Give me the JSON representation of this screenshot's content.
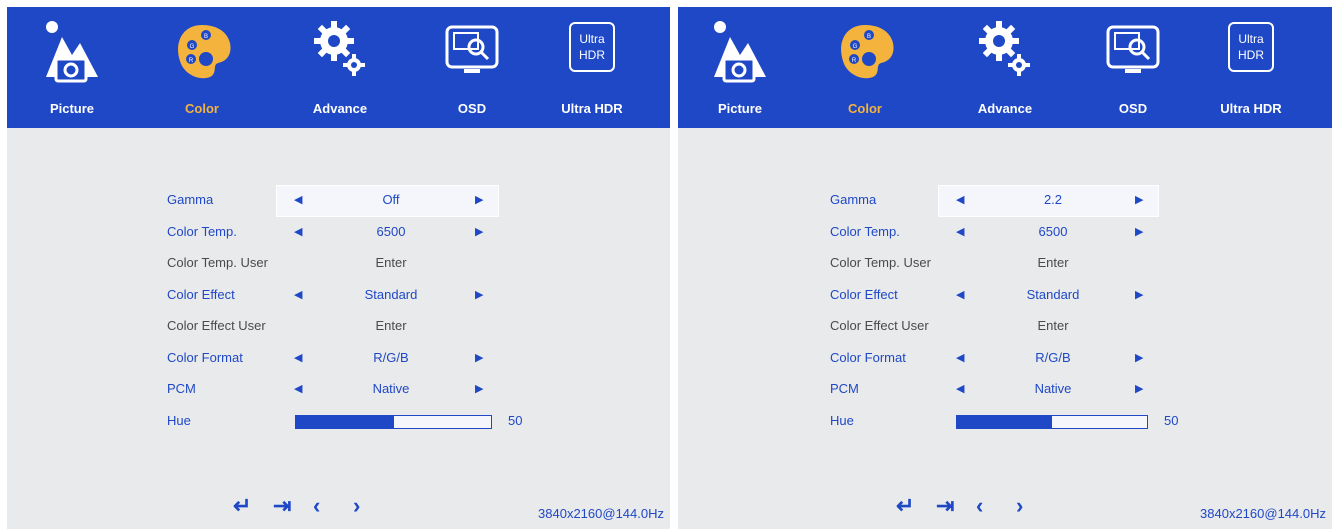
{
  "tabs": [
    {
      "label": "Picture",
      "icon": "picture-icon"
    },
    {
      "label": "Color",
      "icon": "palette-icon"
    },
    {
      "label": "Advance",
      "icon": "gear-icon"
    },
    {
      "label": "OSD",
      "icon": "osd-monitor-icon"
    },
    {
      "label": "Ultra HDR",
      "icon": "ultra-hdr-icon",
      "icon_text": [
        "Ultra",
        "HDR"
      ]
    }
  ],
  "active_tab": "Color",
  "colors": {
    "bar": "#1f48c6",
    "active": "#f3b33d",
    "text": "#1f48c6",
    "dim": "#4a4a4a"
  },
  "panels": [
    {
      "rows": [
        {
          "label": "Gamma",
          "value": "Off",
          "arrows": true,
          "selected": true
        },
        {
          "label": "Color Temp.",
          "value": "6500",
          "arrows": true
        },
        {
          "label": "Color Temp. User",
          "value": "Enter",
          "arrows": false
        },
        {
          "label": "Color Effect",
          "value": "Standard",
          "arrows": true
        },
        {
          "label": "Color Effect User",
          "value": "Enter",
          "arrows": false
        },
        {
          "label": "Color Format",
          "value": "R/G/B",
          "arrows": true
        },
        {
          "label": "PCM",
          "value": "Native",
          "arrows": true
        }
      ],
      "hue": {
        "label": "Hue",
        "value": "50",
        "fraction": 0.5
      },
      "resolution": "3840x2160@144.0Hz"
    },
    {
      "rows": [
        {
          "label": "Gamma",
          "value": "2.2",
          "arrows": true,
          "selected": true
        },
        {
          "label": "Color Temp.",
          "value": "6500",
          "arrows": true
        },
        {
          "label": "Color Temp. User",
          "value": "Enter",
          "arrows": false
        },
        {
          "label": "Color Effect",
          "value": "Standard",
          "arrows": true
        },
        {
          "label": "Color Effect User",
          "value": "Enter",
          "arrows": false
        },
        {
          "label": "Color Format",
          "value": "R/G/B",
          "arrows": true
        },
        {
          "label": "PCM",
          "value": "Native",
          "arrows": true
        }
      ],
      "hue": {
        "label": "Hue",
        "value": "50",
        "fraction": 0.5
      },
      "resolution": "3840x2160@144.0Hz"
    }
  ],
  "nav_icons": [
    "enter-icon",
    "exit-icon",
    "chevron-left-icon",
    "chevron-right-icon"
  ]
}
